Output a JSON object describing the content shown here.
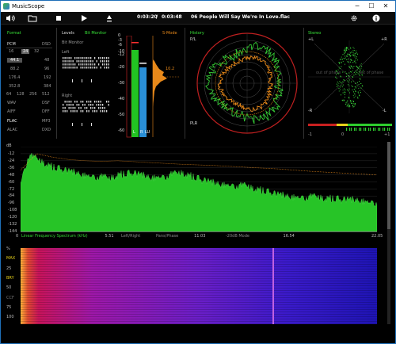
{
  "window": {
    "title": "MusicScope",
    "minimize": "─",
    "maximize": "☐",
    "close": "✕"
  },
  "toolbar": {
    "elapsed": "0:03:20",
    "separator": "/",
    "total": "0:03:48",
    "track": "06 People Will Say We're In Love.flac"
  },
  "format": {
    "title": "Format",
    "pcm": "PCM",
    "dsd": "DSD",
    "bits": [
      "16",
      "24",
      "32"
    ],
    "rates": [
      {
        "pcm": "44.1",
        "dsd": "48"
      },
      {
        "pcm": "88.2",
        "dsd": "96"
      },
      {
        "pcm": "176.4",
        "dsd": "192"
      },
      {
        "pcm": "352.8",
        "dsd": "384"
      }
    ],
    "dsd_rates": [
      "64",
      "128",
      "256",
      "512"
    ],
    "containers": [
      {
        "left": "WAV",
        "right": "DSF"
      },
      {
        "left": "AIFF",
        "right": "DFF"
      },
      {
        "left": "FLAC",
        "right": "MP3"
      },
      {
        "left": "ALAC",
        "right": "DXD"
      }
    ],
    "active": {
      "bits": "24",
      "rate": "44.1",
      "container": "FLAC"
    }
  },
  "levels": {
    "title": "Levels",
    "bit_monitor_label": "Bit Monitor",
    "bit_monitor": "Bit Monitor",
    "left": "Left",
    "right": "Right",
    "smode": "S-Mode",
    "scale": [
      "0",
      "-3",
      "-6",
      "-10",
      "-12",
      "-20",
      "-30",
      "-40",
      "-50",
      "-60"
    ],
    "peak_readout": "10.2",
    "channel_labels": [
      "L",
      "R",
      "LU"
    ]
  },
  "history": {
    "title": "History",
    "top_label": "P/L",
    "bottom_label": "PLR"
  },
  "stereo": {
    "title": "Stereo",
    "plus_l": "+L",
    "plus_r": "+R",
    "minus_r": "-R",
    "minus_l": "-L",
    "out_of_phase_left": "out of phase",
    "out_of_phase_right": "out of phase",
    "correlation_ticks": [
      "-1",
      "0",
      "+1"
    ]
  },
  "spectrum": {
    "db_ticks": [
      "dB",
      "0",
      "-12",
      "-24",
      "-36",
      "-48",
      "-60",
      "-72",
      "-84",
      "-96",
      "-108",
      "-120",
      "-132",
      "-144"
    ],
    "freq_ticks": [
      "0",
      "5.51",
      "11.03",
      "16.54",
      "22.05"
    ],
    "mode": "Linear Frequency Spectrum (kHz)",
    "channel_mode": "Left/Right",
    "phase_mode": "Pans/Phase",
    "range_mode": "-20dB Mode"
  },
  "spectrogram": {
    "ticks": [
      "%",
      "MAX",
      "25",
      "BRY",
      "50",
      "CCF",
      "75",
      "100"
    ]
  },
  "colors": {
    "green": "#2ecc2e",
    "orange": "#e8891a",
    "red": "#e02020",
    "blue": "#2a8fd6",
    "title_green": "#38e338"
  },
  "chart_data": {
    "type": "area",
    "xlabel": "Linear Frequency Spectrum (kHz)",
    "ylabel": "dB",
    "xlim": [
      0,
      22.05
    ],
    "ylim": [
      -144,
      0
    ],
    "series": [
      {
        "values": [
          [
            0,
            -60
          ],
          [
            0.5,
            -15
          ],
          [
            1,
            -22
          ],
          [
            2,
            -35
          ],
          [
            3,
            -42
          ],
          [
            4,
            -48
          ],
          [
            5,
            -52
          ],
          [
            5.51,
            -55
          ],
          [
            6,
            -48
          ],
          [
            7,
            -45
          ],
          [
            8,
            -52
          ],
          [
            9,
            -50
          ],
          [
            10,
            -45
          ],
          [
            11.03,
            -55
          ],
          [
            12,
            -62
          ],
          [
            13,
            -65
          ],
          [
            14,
            -68
          ],
          [
            15,
            -75
          ],
          [
            16,
            -82
          ],
          [
            16.54,
            -84
          ],
          [
            17,
            -85
          ],
          [
            18,
            -86
          ],
          [
            19,
            -88
          ],
          [
            20,
            -90
          ],
          [
            21,
            -91
          ],
          [
            22.05,
            -95
          ]
        ]
      },
      {
        "values": [
          [
            0,
            -40
          ],
          [
            1,
            -12
          ],
          [
            2,
            -18
          ],
          [
            3,
            -22
          ],
          [
            4,
            -24
          ],
          [
            5,
            -25
          ],
          [
            6,
            -24
          ],
          [
            8,
            -27
          ],
          [
            10,
            -30
          ],
          [
            12,
            -32
          ],
          [
            14,
            -35
          ],
          [
            16,
            -38
          ],
          [
            18,
            -42
          ],
          [
            20,
            -45
          ],
          [
            22.05,
            -48
          ]
        ]
      }
    ]
  }
}
